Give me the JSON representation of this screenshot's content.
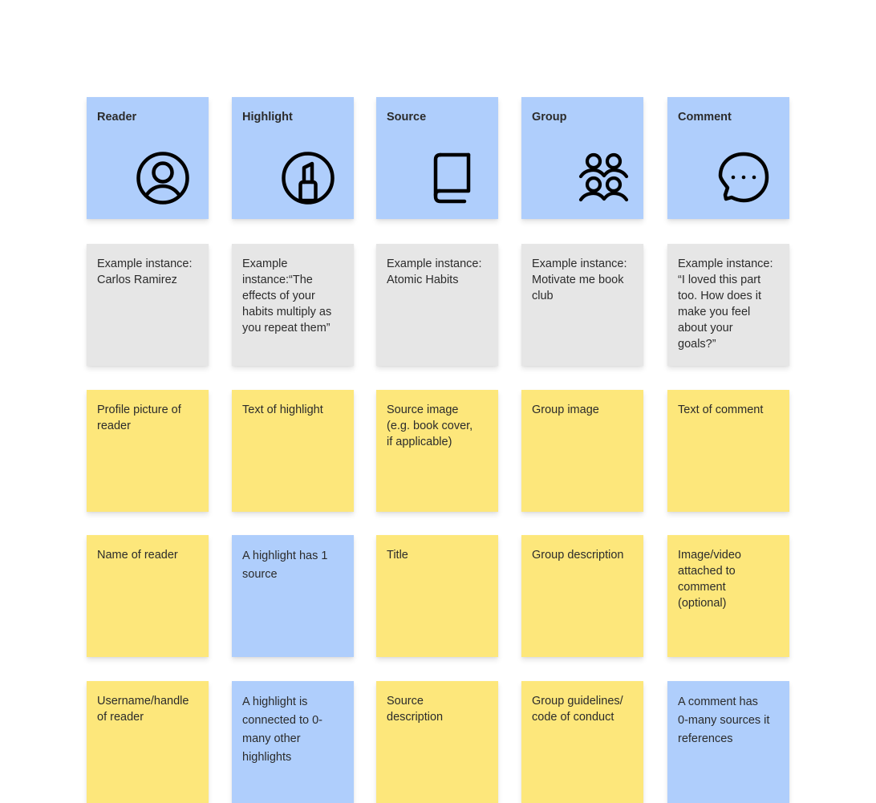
{
  "colors": {
    "entity_blue": "#afcefc",
    "example_gray": "#e6e6e6",
    "attribute_yellow": "#fde77b",
    "relationship_blue": "#afcefc",
    "text": "#2b2b2b",
    "icon": "#000000"
  },
  "entities": [
    {
      "title": "Reader",
      "icon": "user-circle-icon",
      "example": "Example instance:\nCarlos Ramirez",
      "notes": [
        {
          "text": "Profile picture of\nreader",
          "kind": "attribute"
        },
        {
          "text": "Name of reader",
          "kind": "attribute"
        },
        {
          "text": "Username/handle\nof reader",
          "kind": "attribute"
        }
      ]
    },
    {
      "title": "Highlight",
      "icon": "highlighter-circle-icon",
      "example": "Example\ninstance:“The\neffects of your\nhabits multiply as\nyou repeat them”",
      "notes": [
        {
          "text": "Text of highlight",
          "kind": "attribute"
        },
        {
          "text": "A highlight has 1\nsource",
          "kind": "relationship"
        },
        {
          "text": "A highlight is\nconnected to 0-\nmany other\nhighlights",
          "kind": "relationship"
        }
      ]
    },
    {
      "title": "Source",
      "icon": "book-icon",
      "example": "Example instance:\nAtomic Habits",
      "notes": [
        {
          "text": "Source image\n(e.g. book cover,\nif applicable)",
          "kind": "attribute"
        },
        {
          "text": "Title",
          "kind": "attribute"
        },
        {
          "text": "Source\ndescription",
          "kind": "attribute"
        }
      ]
    },
    {
      "title": "Group",
      "icon": "group-icon",
      "example": "Example instance:\nMotivate me book\nclub",
      "notes": [
        {
          "text": "Group image",
          "kind": "attribute"
        },
        {
          "text": "Group description",
          "kind": "attribute"
        },
        {
          "text": "Group guidelines/\ncode of conduct",
          "kind": "attribute"
        }
      ]
    },
    {
      "title": "Comment",
      "icon": "chat-bubble-icon",
      "example": "Example instance:\n“I loved this part\ntoo. How does it\nmake you feel\nabout your\ngoals?”",
      "notes": [
        {
          "text": "Text of comment",
          "kind": "attribute"
        },
        {
          "text": "Image/video\nattached to\ncomment\n(optional)",
          "kind": "attribute"
        },
        {
          "text": "A comment has\n0-many sources it\nreferences",
          "kind": "relationship"
        }
      ]
    }
  ]
}
